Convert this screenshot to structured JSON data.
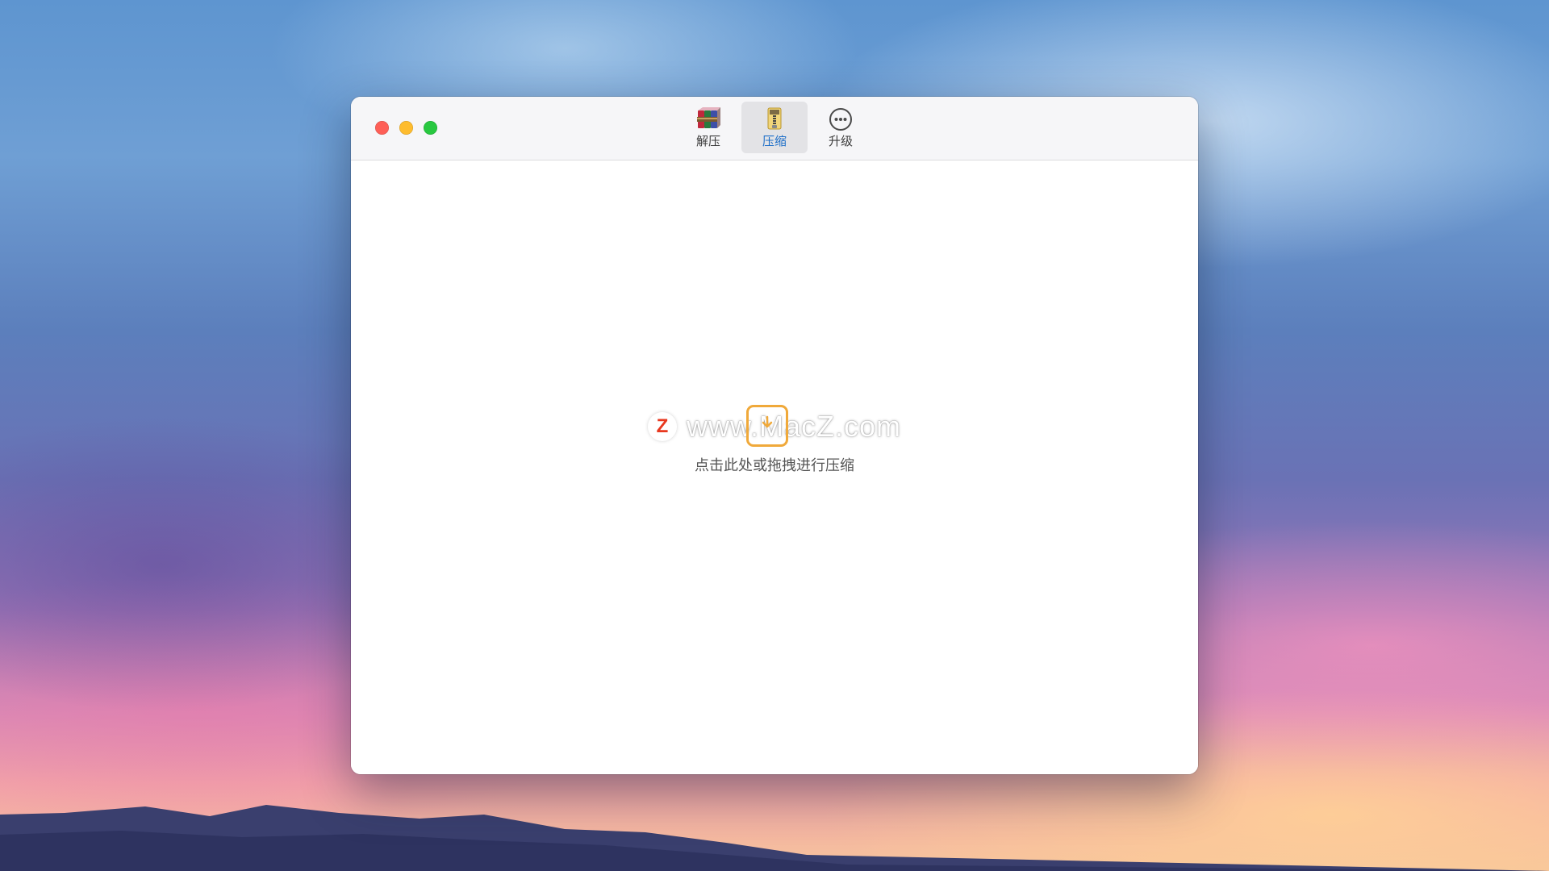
{
  "window": {
    "toolbar": {
      "items": [
        {
          "label": "解压",
          "icon": "archive-books-icon",
          "active": false
        },
        {
          "label": "压缩",
          "icon": "zip-file-icon",
          "active": true
        },
        {
          "label": "升级",
          "icon": "more-circle-icon",
          "active": false
        }
      ]
    },
    "dropzone": {
      "watermark": {
        "badge": "Z",
        "text": "www.MacZ.com",
        "badge_color": "#e8381f",
        "frame_color": "#f0a93a"
      },
      "hint": "点击此处或拖拽进行压缩"
    }
  },
  "colors": {
    "close": "#fe5f57",
    "minimize": "#febc2e",
    "zoom": "#28c840",
    "active_label": "#1e6fc8"
  }
}
